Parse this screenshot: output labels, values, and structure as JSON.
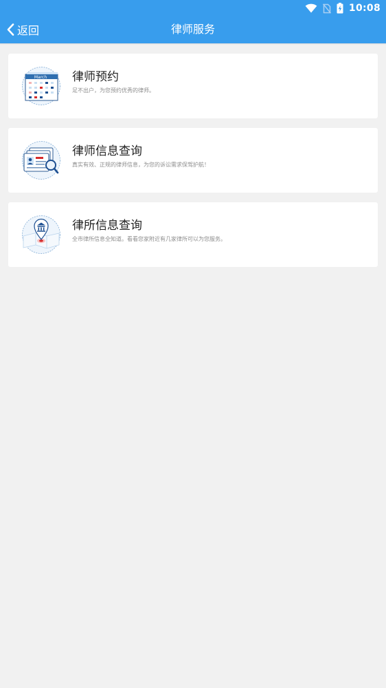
{
  "status_bar": {
    "time": "10:08",
    "icons": [
      "wifi-icon",
      "no-sim-icon",
      "battery-charging-icon"
    ]
  },
  "nav": {
    "back_label": "返回",
    "title": "律师服务"
  },
  "services": [
    {
      "icon": "calendar-icon",
      "calendar_month": "March",
      "title": "律师预约",
      "description": "足不出户，为您预约优秀的律师。"
    },
    {
      "icon": "id-card-search-icon",
      "title": "律师信息查询",
      "description": "真实有效、正规的律师信息，为您的诉讼需求保驾护航！"
    },
    {
      "icon": "law-firm-location-icon",
      "title": "律所信息查询",
      "description": "全市律所信息全知道。看看您家附近有几家律所可以为您服务。"
    }
  ],
  "colors": {
    "primary": "#389ded",
    "background": "#f1f1f1",
    "card": "#ffffff",
    "title_text": "#222222",
    "desc_text": "#8d8d8d"
  }
}
